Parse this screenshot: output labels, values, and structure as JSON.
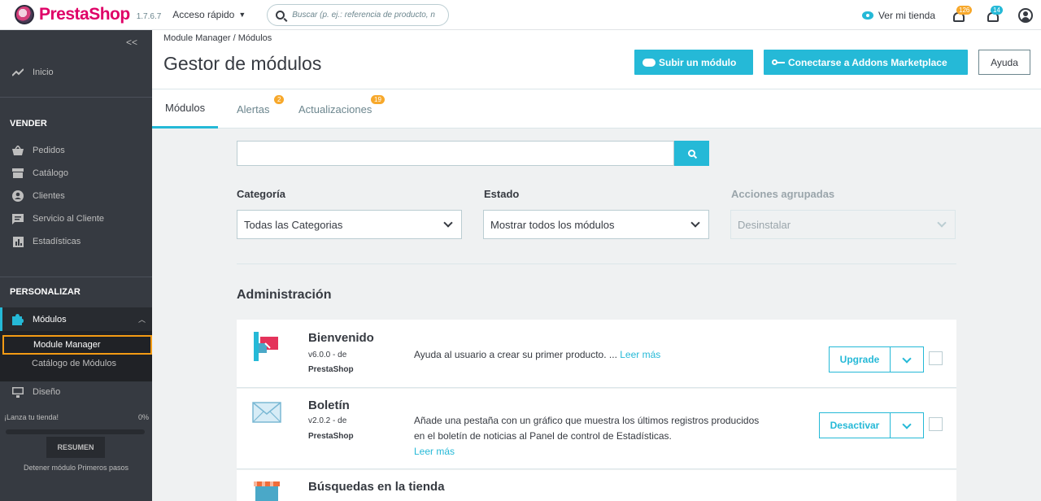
{
  "topbar": {
    "logo_text": "PrestaShop",
    "version": "1.7.6.7",
    "quick_access": "Acceso rápido",
    "search_placeholder": "Buscar (p. ej.: referencia de producto, n",
    "view_shop": "Ver mi tienda",
    "orders_badge": "126",
    "customers_badge": "14"
  },
  "sidebar": {
    "collapse": "<<",
    "home": "Inicio",
    "sell_title": "VENDER",
    "sell_items": [
      "Pedidos",
      "Catálogo",
      "Clientes",
      "Servicio al Cliente",
      "Estadísticas"
    ],
    "customize_title": "PERSONALIZAR",
    "modules": "Módulos",
    "module_manager": "Module Manager",
    "module_catalog": "Catálogo de Módulos",
    "design": "Diseño",
    "launch_label": "¡Lanza tu tienda!",
    "launch_percent": "0%",
    "launch_progress": 0,
    "summary_button": "RESUMEN",
    "stop_onboarding": "Detener módulo Primeros pasos"
  },
  "header": {
    "breadcrumb": "Module Manager / Módulos",
    "title": "Gestor de módulos",
    "upload_button": "Subir un módulo",
    "addons_button": "Conectarse a Addons Marketplace",
    "help_button": "Ayuda"
  },
  "tabs": [
    {
      "label": "Módulos",
      "badge": ""
    },
    {
      "label": "Alertas",
      "badge": "2"
    },
    {
      "label": "Actualizaciones",
      "badge": "19"
    }
  ],
  "filters": {
    "search_value": "",
    "category_label": "Categoría",
    "category_value": "Todas las Categorias",
    "status_label": "Estado",
    "status_value": "Mostrar todos los módulos",
    "bulk_label": "Acciones agrupadas",
    "bulk_value": "Desinstalar"
  },
  "section_title": "Administración",
  "modules": [
    {
      "name": "Bienvenido",
      "version": "v6.0.0 - de",
      "author": "PrestaShop",
      "description": "Ayuda al usuario a crear su primer producto. ...",
      "read_more": "Leer más",
      "action": "Upgrade"
    },
    {
      "name": "Boletín",
      "version": "v2.0.2 - de",
      "author": "PrestaShop",
      "description": "Añade una pestaña con un gráfico que muestra los últimos registros producidos en el boletín de noticias al Panel de control de Estadísticas.",
      "read_more": "Leer más",
      "action": "Desactivar"
    },
    {
      "name": "Búsquedas en la tienda"
    }
  ],
  "colors": {
    "accent": "#25b9d7",
    "brand": "#df0067",
    "sidebar_bg": "#363a41",
    "badge": "#f7a82b",
    "highlight": "#f49b14"
  }
}
